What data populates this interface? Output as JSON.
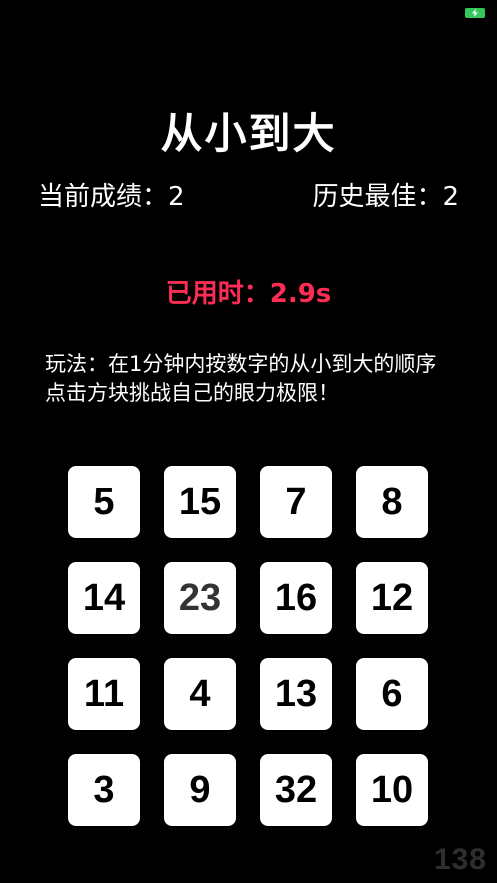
{
  "status_bar": {
    "battery_icon": "battery-charging-icon",
    "battery_color": "#34c759"
  },
  "title": "从小到大",
  "scores": {
    "current_label": "当前成绩：",
    "current_value": "2",
    "best_label": "历史最佳：",
    "best_value": "2"
  },
  "timer": {
    "label": "已用时：",
    "value": "2.9s",
    "color": "#ff2d55"
  },
  "instructions": "玩法：在1分钟内按数字的从小到大的顺序点击方块挑战自己的眼力极限！",
  "tiles": [
    {
      "label": "5",
      "color": "#000000"
    },
    {
      "label": "15",
      "color": "#000000"
    },
    {
      "label": "7",
      "color": "#000000"
    },
    {
      "label": "8",
      "color": "#000000"
    },
    {
      "label": "14",
      "color": "#000000"
    },
    {
      "label": "23",
      "color": "#333333"
    },
    {
      "label": "16",
      "color": "#000000"
    },
    {
      "label": "12",
      "color": "#000000"
    },
    {
      "label": "11",
      "color": "#000000"
    },
    {
      "label": "4",
      "color": "#000000"
    },
    {
      "label": "13",
      "color": "#000000"
    },
    {
      "label": "6",
      "color": "#000000"
    },
    {
      "label": "3",
      "color": "#000000"
    },
    {
      "label": "9",
      "color": "#000000"
    },
    {
      "label": "32",
      "color": "#000000"
    },
    {
      "label": "10",
      "color": "#000000"
    }
  ],
  "watermark": "138"
}
